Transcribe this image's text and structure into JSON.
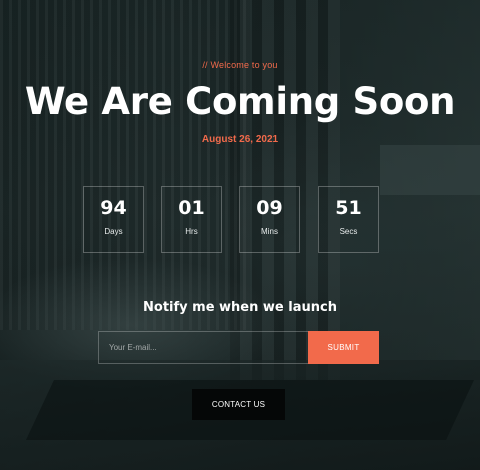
{
  "hero": {
    "welcome": "// Welcome to you",
    "title": "We Are Coming Soon",
    "date": "August 26, 2021"
  },
  "countdown": [
    {
      "value": "94",
      "label": "Days"
    },
    {
      "value": "01",
      "label": "Hrs"
    },
    {
      "value": "09",
      "label": "Mins"
    },
    {
      "value": "51",
      "label": "Secs"
    }
  ],
  "notify": {
    "heading": "Notify me when we launch",
    "email_placeholder": "Your E-mail...",
    "submit_label": "SUBMIT"
  },
  "contact": {
    "button_label": "CONTACT US"
  },
  "colors": {
    "accent": "#f26a4b",
    "overlay": "#1e2a2a",
    "contact_button": "#050707"
  }
}
